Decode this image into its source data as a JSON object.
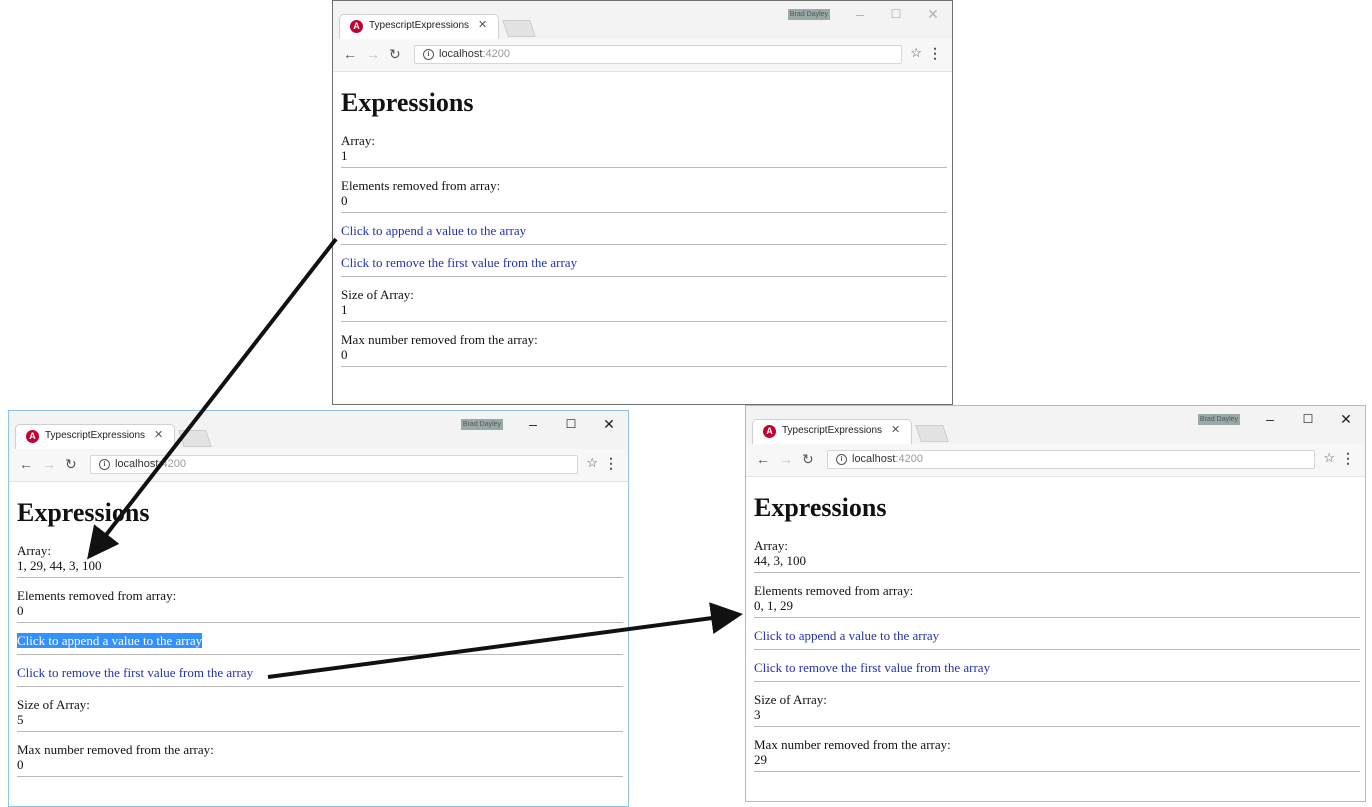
{
  "windows": [
    {
      "tab_title": "TypescriptExpressions",
      "badge": "Brad Dayley",
      "url_host": "localhost",
      "url_port": ":4200",
      "page_title": "Expressions",
      "array_label": "Array:",
      "array_value": "1",
      "removed_label": "Elements removed from array:",
      "removed_value": "0",
      "append_link": "Click to append a value to the array",
      "remove_link": "Click to remove the first value from the array",
      "size_label": "Size of Array:",
      "size_value": "1",
      "max_label": "Max number removed from the array:",
      "max_value": "0",
      "append_selected": false
    },
    {
      "tab_title": "TypescriptExpressions",
      "badge": "Brad Dayley",
      "url_host": "localhost",
      "url_port": ":4200",
      "page_title": "Expressions",
      "array_label": "Array:",
      "array_value": "1, 29, 44, 3, 100",
      "removed_label": "Elements removed from array:",
      "removed_value": "0",
      "append_link": "Click to append a value to the array",
      "remove_link": "Click to remove the first value from the array",
      "size_label": "Size of Array:",
      "size_value": "5",
      "max_label": "Max number removed from the array:",
      "max_value": "0",
      "append_selected": true
    },
    {
      "tab_title": "TypescriptExpressions",
      "badge": "Brad Dayley",
      "url_host": "localhost",
      "url_port": ":4200",
      "page_title": "Expressions",
      "array_label": "Array:",
      "array_value": "44, 3, 100",
      "removed_label": "Elements removed from array:",
      "removed_value": "0, 1, 29",
      "append_link": "Click to append a value to the array",
      "remove_link": "Click to remove the first value from the array",
      "size_label": "Size of Array:",
      "size_value": "3",
      "max_label": "Max number removed from the array:",
      "max_value": "29",
      "append_selected": false
    }
  ],
  "icons": {
    "tab_favicon": "angular-icon",
    "tab_close": "close-icon",
    "back": "back-arrow-icon",
    "forward": "forward-arrow-icon",
    "reload": "reload-icon",
    "site_info": "info-icon",
    "bookmark": "star-icon",
    "menu": "kebab-menu-icon",
    "minimize": "minimize-icon",
    "maximize": "maximize-icon",
    "close_window": "close-icon"
  },
  "colors": {
    "link": "#2232a8",
    "selection": "#3390ff",
    "active_window_border": "#8fc4e8",
    "favicon": "#c3002f"
  }
}
